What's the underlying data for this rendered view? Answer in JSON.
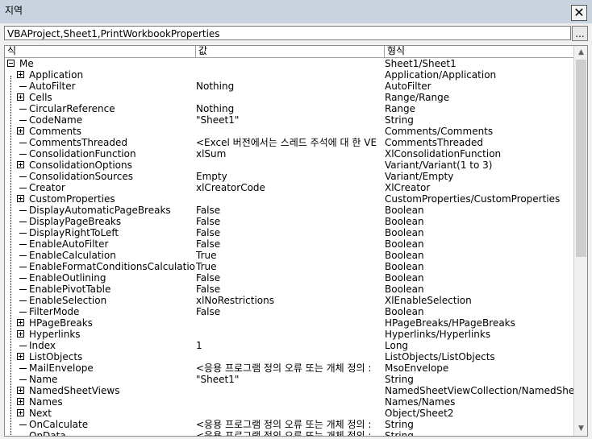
{
  "window": {
    "title": "지역",
    "close_label": "✕",
    "context": "VBAProject,Sheet1,PrintWorkbookProperties",
    "ellipsis_label": "..."
  },
  "columns": {
    "expression": "식",
    "value": "값",
    "type": "형식"
  },
  "scrollbar": {
    "up_label": "▲",
    "down_label": "▼"
  },
  "rows": [
    {
      "name": "Me",
      "value": "",
      "type": "Sheet1/Sheet1",
      "kind": "root"
    },
    {
      "name": "Application",
      "value": "",
      "type": "Application/Application",
      "kind": "plus"
    },
    {
      "name": "AutoFilter",
      "value": "Nothing",
      "type": "AutoFilter",
      "kind": "leaf"
    },
    {
      "name": "Cells",
      "value": "",
      "type": "Range/Range",
      "kind": "plus"
    },
    {
      "name": "CircularReference",
      "value": "Nothing",
      "type": "Range",
      "kind": "leaf"
    },
    {
      "name": "CodeName",
      "value": "\"Sheet1\"",
      "type": "String",
      "kind": "leaf"
    },
    {
      "name": "Comments",
      "value": "",
      "type": "Comments/Comments",
      "kind": "plus"
    },
    {
      "name": "CommentsThreaded",
      "value": "<Excel 버전에서는 스레드 주석에 대 한 VE",
      "type": "CommentsThreaded",
      "kind": "leaf"
    },
    {
      "name": "ConsolidationFunction",
      "value": "xlSum",
      "type": "XlConsolidationFunction",
      "kind": "leaf"
    },
    {
      "name": "ConsolidationOptions",
      "value": "",
      "type": "Variant/Variant(1 to 3)",
      "kind": "plus"
    },
    {
      "name": "ConsolidationSources",
      "value": "Empty",
      "type": "Variant/Empty",
      "kind": "leaf"
    },
    {
      "name": "Creator",
      "value": "xlCreatorCode",
      "type": "XlCreator",
      "kind": "leaf"
    },
    {
      "name": "CustomProperties",
      "value": "",
      "type": "CustomProperties/CustomProperties",
      "kind": "plus"
    },
    {
      "name": "DisplayAutomaticPageBreaks",
      "value": "False",
      "type": "Boolean",
      "kind": "leaf"
    },
    {
      "name": "DisplayPageBreaks",
      "value": "False",
      "type": "Boolean",
      "kind": "leaf"
    },
    {
      "name": "DisplayRightToLeft",
      "value": "False",
      "type": "Boolean",
      "kind": "leaf"
    },
    {
      "name": "EnableAutoFilter",
      "value": "False",
      "type": "Boolean",
      "kind": "leaf"
    },
    {
      "name": "EnableCalculation",
      "value": "True",
      "type": "Boolean",
      "kind": "leaf"
    },
    {
      "name": "EnableFormatConditionsCalculation",
      "value": "True",
      "type": "Boolean",
      "kind": "leaf"
    },
    {
      "name": "EnableOutlining",
      "value": "False",
      "type": "Boolean",
      "kind": "leaf"
    },
    {
      "name": "EnablePivotTable",
      "value": "False",
      "type": "Boolean",
      "kind": "leaf"
    },
    {
      "name": "EnableSelection",
      "value": "xlNoRestrictions",
      "type": "XlEnableSelection",
      "kind": "leaf"
    },
    {
      "name": "FilterMode",
      "value": "False",
      "type": "Boolean",
      "kind": "leaf"
    },
    {
      "name": "HPageBreaks",
      "value": "",
      "type": "HPageBreaks/HPageBreaks",
      "kind": "plus"
    },
    {
      "name": "Hyperlinks",
      "value": "",
      "type": "Hyperlinks/Hyperlinks",
      "kind": "plus"
    },
    {
      "name": "Index",
      "value": "1",
      "type": "Long",
      "kind": "leaf"
    },
    {
      "name": "ListObjects",
      "value": "",
      "type": "ListObjects/ListObjects",
      "kind": "plus"
    },
    {
      "name": "MailEnvelope",
      "value": "<응용 프로그램 정의 오류 또는 개체 정의 :",
      "type": "MsoEnvelope",
      "kind": "leaf"
    },
    {
      "name": "Name",
      "value": "\"Sheet1\"",
      "type": "String",
      "kind": "leaf"
    },
    {
      "name": "NamedSheetViews",
      "value": "",
      "type": "NamedSheetViewCollection/NamedSheetViewCollection",
      "kind": "plus"
    },
    {
      "name": "Names",
      "value": "",
      "type": "Names/Names",
      "kind": "plus"
    },
    {
      "name": "Next",
      "value": "",
      "type": "Object/Sheet2",
      "kind": "plus"
    },
    {
      "name": "OnCalculate",
      "value": "<응용 프로그램 정의 오류 또는 개체 정의 :",
      "type": "String",
      "kind": "leaf"
    },
    {
      "name": "OnData",
      "value": "<응용 프로그램 정의 오류 또는 개체 정의 :",
      "type": "String",
      "kind": "leaf"
    }
  ]
}
